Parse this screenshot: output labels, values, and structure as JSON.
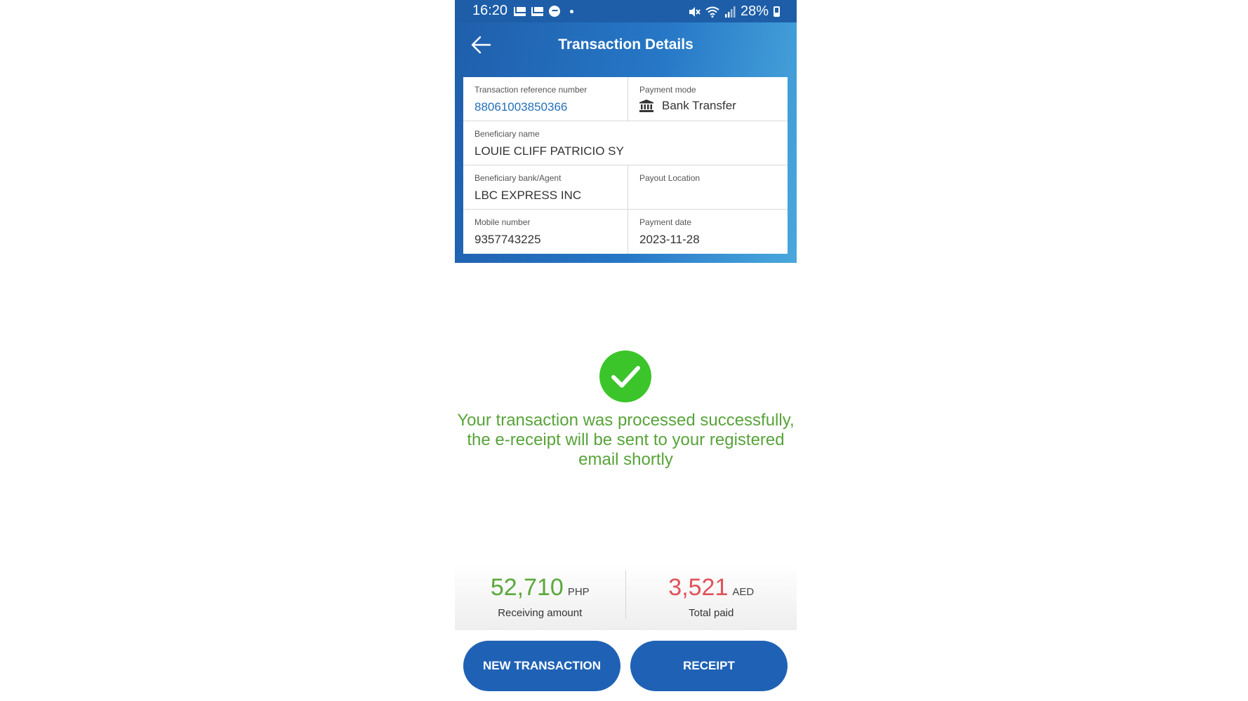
{
  "status_bar": {
    "time": "16:20",
    "battery": "28%",
    "icons": [
      "mail-icon",
      "mail-icon",
      "messenger-icon",
      "dot-icon",
      "mute-icon",
      "wifi-icon",
      "signal-icon",
      "battery-icon"
    ]
  },
  "header": {
    "title": "Transaction Details",
    "back_icon": "arrow-left-icon"
  },
  "details": {
    "ref_label": "Transaction reference number",
    "ref_value": "88061003850366",
    "mode_label": "Payment mode",
    "mode_value": "Bank Transfer",
    "mode_icon": "bank-icon",
    "beneficiary_label": "Beneficiary name",
    "beneficiary_value": "LOUIE CLIFF PATRICIO SY",
    "bank_label": "Beneficiary bank/Agent",
    "bank_value": "LBC EXPRESS INC",
    "payout_label": "Payout Location",
    "payout_value": "",
    "mobile_label": "Mobile number",
    "mobile_value": "9357743225",
    "date_label": "Payment date",
    "date_value": "2023-11-28"
  },
  "success": {
    "icon": "checkmark-circle-icon",
    "message": "Your transaction was processed successfully, the e-receipt will be sent to your registered email shortly"
  },
  "summary": {
    "receiving_amount": "52,710",
    "receiving_currency": "PHP",
    "receiving_label": "Receiving amount",
    "total_paid": "3,521",
    "total_currency": "AED",
    "total_label": "Total paid"
  },
  "actions": {
    "new_transaction": "NEW TRANSACTION",
    "receipt": "RECEIPT"
  },
  "colors": {
    "header_blue": "#1f5fac",
    "success_green": "#3bc52a",
    "message_green": "#58a33a",
    "amount_green": "#5aa83c",
    "amount_red": "#e0525a",
    "button_blue": "#1f62b5"
  }
}
